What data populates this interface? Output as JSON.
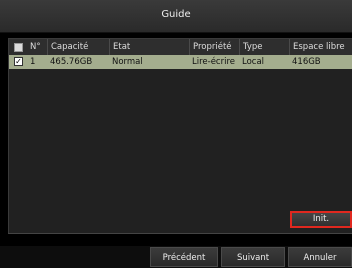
{
  "window": {
    "title": "Guide"
  },
  "table": {
    "headers": [
      "N°",
      "Capacité",
      "Etat",
      "Propriété",
      "Type",
      "Espace libre"
    ],
    "rows": [
      {
        "checked": true,
        "number": "1",
        "capacity": "465.76GB",
        "state": "Normal",
        "property": "Lire-écrire",
        "type": "Local",
        "free": "416GB"
      }
    ]
  },
  "buttons": {
    "init": "Init.",
    "previous": "Précédent",
    "next": "Suivant",
    "cancel": "Annuler"
  },
  "colors": {
    "selected_row": "#a4ad8e",
    "highlight_border": "#e0281f"
  }
}
